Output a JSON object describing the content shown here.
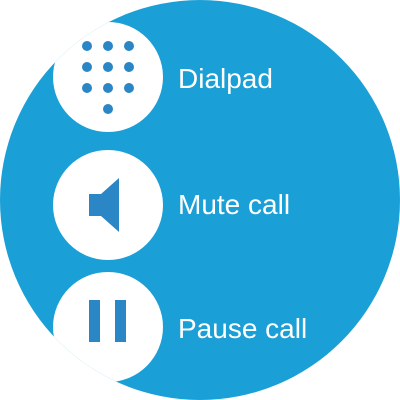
{
  "colors": {
    "background": "#1a9fd6",
    "icon_circle": "#ffffff",
    "icon_glyph": "#2b86c5",
    "label_text": "#ffffff"
  },
  "menu": {
    "items": [
      {
        "label": "Dialpad",
        "icon": "dialpad-icon"
      },
      {
        "label": "Mute call",
        "icon": "volume-icon"
      },
      {
        "label": "Pause call",
        "icon": "pause-icon"
      }
    ]
  }
}
